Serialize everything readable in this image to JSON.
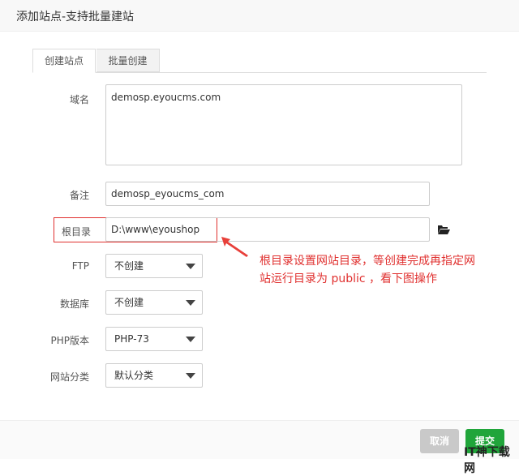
{
  "dialog": {
    "title": "添加站点-支持批量建站"
  },
  "tabs": [
    {
      "label": "创建站点"
    },
    {
      "label": "批量创建"
    }
  ],
  "form": {
    "domain": {
      "label": "域名",
      "value": "demosp.eyoucms.com"
    },
    "remark": {
      "label": "备注",
      "value": "demosp_eyoucms_com"
    },
    "root": {
      "label": "根目录",
      "value": "D:\\www\\eyoushop"
    },
    "ftp": {
      "label": "FTP",
      "value": "不创建"
    },
    "db": {
      "label": "数据库",
      "value": "不创建"
    },
    "php": {
      "label": "PHP版本",
      "value": "PHP-73"
    },
    "category": {
      "label": "网站分类",
      "value": "默认分类"
    }
  },
  "annotation": {
    "line1": "根目录设置网站目录，等创建完成再指定网",
    "line2": "站运行目录为 public ，看下图操作",
    "color": "#e0302f"
  },
  "footer": {
    "cancel": "取消",
    "submit": "提交"
  },
  "watermark": "IT神下载网"
}
